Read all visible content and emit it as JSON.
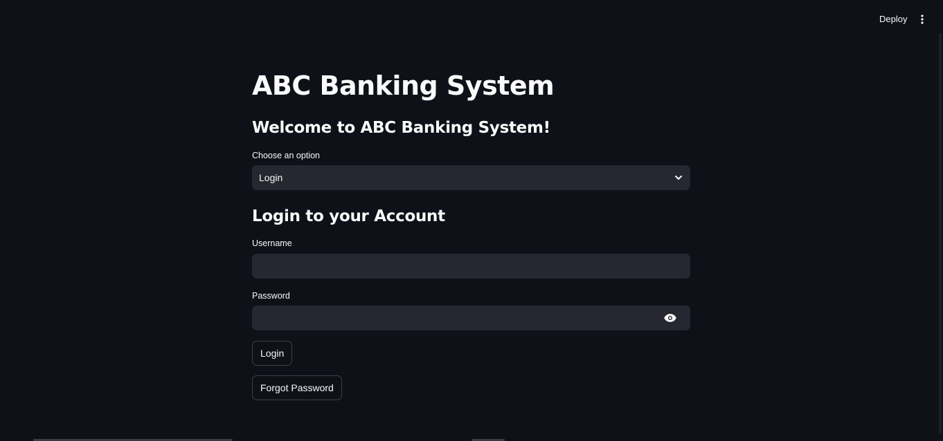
{
  "header": {
    "deploy_label": "Deploy",
    "menu_icon": "more-vertical-icon"
  },
  "main": {
    "title": "ABC Banking System",
    "welcome": "Welcome to ABC Banking System!",
    "option_select": {
      "label": "Choose an option",
      "selected": "Login",
      "icon": "chevron-down-icon"
    },
    "login_section": {
      "title": "Login to your Account",
      "username": {
        "label": "Username",
        "value": "",
        "placeholder": ""
      },
      "password": {
        "label": "Password",
        "value": "",
        "placeholder": "",
        "icon": "eye-icon"
      },
      "login_button": "Login",
      "forgot_button": "Forgot Password"
    }
  },
  "colors": {
    "background": "#0e1117",
    "input_background": "#262730",
    "text": "#fafafa",
    "button_border": "#3d4049"
  }
}
